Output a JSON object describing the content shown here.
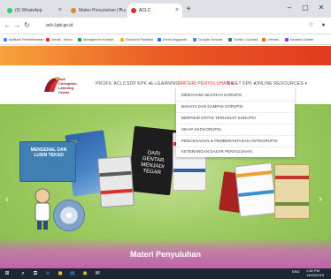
{
  "browser": {
    "tabs": [
      {
        "title": "(9) WhatsApp",
        "active": false,
        "favicon_color": "#25d366"
      },
      {
        "title": "Materi Penyuluhan | Pusat Edukasi…",
        "active": false,
        "favicon_color": "#e0862b"
      },
      {
        "title": "ACLC",
        "active": true,
        "favicon_color": "#d7312a"
      }
    ],
    "new_tab": "+",
    "window_controls": [
      "–",
      "▢",
      "✕"
    ],
    "url": "aclc.kpk.go.id",
    "bookmarks": [
      {
        "label": "Aplikasi Pemeliharaan",
        "color": "#4285f4"
      },
      {
        "label": "Gmail - Inbox",
        "color": "#d93025"
      },
      {
        "label": "Manajemen Kinerja",
        "color": "#0f9d58"
      },
      {
        "label": "Ekonomi Fasilitas",
        "color": "#f4b400"
      },
      {
        "label": "Drive Anggaran",
        "color": "#1a73e8"
      },
      {
        "label": "Google Scholar",
        "color": "#4285f4"
      },
      {
        "label": "Scribd | Upload",
        "color": "#1e7b85"
      },
      {
        "label": "Literasi",
        "color": "#e37400"
      },
      {
        "label": "Intranet Online",
        "color": "#9334e6"
      }
    ]
  },
  "site": {
    "logo_text": [
      "Anti",
      "Corruption",
      "Learning",
      "Center"
    ],
    "nav": [
      {
        "label": "PROFIL ACLC",
        "active": false
      },
      {
        "label": "SDP KPK ▾",
        "active": false
      },
      {
        "label": "E-LEARNING",
        "active": false
      },
      {
        "label": "MATERI PENYULUHAN ▾",
        "active": true
      },
      {
        "label": "RISET KPK ▾",
        "active": false
      },
      {
        "label": "ONLINE RESOURCES ▾",
        "active": false
      }
    ],
    "dropdown": [
      "MEMAHAMI SEJARAH KORUPSI",
      "BAHAYA DAN DAMPAK KORUPSI",
      "BERPIKIR KRITIS TERHADAP KORUPSI",
      "SIKAP ANTIKORUPSI",
      "PENCEGAHAN & PEMBERANTASAN ANTIKORUPSI",
      "KETERANGAN DASAR PENYULUHAN"
    ],
    "hero": {
      "caption": "Materi Penyuluhan",
      "book1_title": "MENGENAL DAN LUSIN TEKAD",
      "book2_title": "KPK",
      "book3_title": "DARI GENTAR MENJADI TEGAR",
      "prev": "‹",
      "next": "›"
    }
  },
  "taskbar": {
    "start": "⊞",
    "icons": [
      "⌕",
      "⧉",
      "e",
      "◼",
      "▤",
      "◉",
      "✉"
    ],
    "tray_time": "1:50 PM",
    "tray_date": "14/02/2019",
    "tray_lang": "ENG"
  }
}
